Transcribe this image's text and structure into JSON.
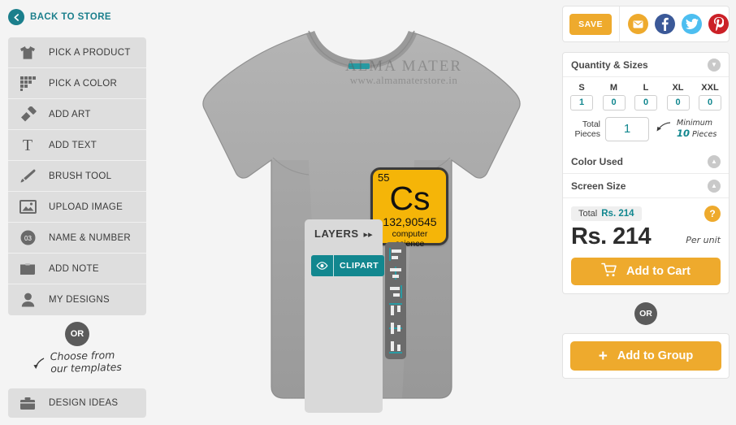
{
  "back": {
    "label": "BACK TO STORE",
    "icon": "chevron-left-icon",
    "color": "#1b7f8c"
  },
  "sidebar": {
    "items": [
      {
        "label": "PICK A PRODUCT",
        "icon": "tshirt-icon"
      },
      {
        "label": "PICK A COLOR",
        "icon": "color-swatch-icon"
      },
      {
        "label": "ADD ART",
        "icon": "paint-brush-wide-icon"
      },
      {
        "label": "ADD TEXT",
        "icon": "text-t-icon"
      },
      {
        "label": "BRUSH TOOL",
        "icon": "brush-icon"
      },
      {
        "label": "UPLOAD IMAGE",
        "icon": "image-icon"
      },
      {
        "label": "NAME & NUMBER",
        "icon": "number-badge-icon"
      },
      {
        "label": "ADD NOTE",
        "icon": "note-icon"
      },
      {
        "label": "MY DESIGNS",
        "icon": "user-icon"
      }
    ],
    "or_label": "OR",
    "templates_note_line1": "Choose from",
    "templates_note_line2": "our templates",
    "design_ideas": {
      "label": "DESIGN IDEAS",
      "icon": "briefcase-icon"
    }
  },
  "canvas": {
    "product": "grey-tshirt",
    "watermark_title": "ALMA MATER",
    "watermark_url": "www.almamaterstore.in",
    "shirt_color": "#a8a8a8",
    "design": {
      "type": "periodic-element-tile",
      "atomic_number": "55",
      "symbol": "Cs",
      "atomic_weight": "132,90545",
      "name": "computer science",
      "tile_color": "#f5b508",
      "border_color": "#3a3a3a"
    }
  },
  "layers": {
    "title": "LAYERS",
    "collapse_icon": "double-chevron-right-icon",
    "rows": [
      {
        "name": "CLIPART",
        "visible_icon": "eye-icon",
        "color": "#12878f"
      }
    ],
    "align_tools": [
      "align-left-icon",
      "align-center-horizontal-icon",
      "align-right-icon",
      "align-top-icon",
      "align-middle-vertical-icon",
      "align-bottom-icon"
    ]
  },
  "right": {
    "save_label": "SAVE",
    "social": [
      {
        "name": "email-icon",
        "color": "#eeaa2d"
      },
      {
        "name": "facebook-icon",
        "color": "#3b5998"
      },
      {
        "name": "twitter-icon",
        "color": "#4dbef0"
      },
      {
        "name": "pinterest-icon",
        "color": "#cb2027"
      }
    ],
    "quantity": {
      "header": "Quantity & Sizes",
      "chevron": "chevron-down-icon",
      "sizes": [
        {
          "label": "S",
          "value": "1"
        },
        {
          "label": "M",
          "value": "0"
        },
        {
          "label": "L",
          "value": "0"
        },
        {
          "label": "XL",
          "value": "0"
        },
        {
          "label": "XXL",
          "value": "0"
        }
      ],
      "total_label_line1": "Total",
      "total_label_line2": "Pieces",
      "total_value": "1",
      "arrow_icon": "arrow-left-curved-icon",
      "minimum_label": "Minimum",
      "minimum_value": "10",
      "minimum_unit": "Pieces"
    },
    "color_used": {
      "header": "Color Used",
      "chevron": "chevron-up-icon"
    },
    "screen_size": {
      "header": "Screen Size",
      "chevron": "chevron-up-icon"
    },
    "price": {
      "total_label": "Total",
      "total_value": "Rs. 214",
      "help_label": "?",
      "grand_total": "Rs. 214",
      "per_unit": "Per unit",
      "add_to_cart": "Add to Cart",
      "cart_icon": "shopping-cart-icon",
      "accent": "#eeaa2d",
      "teal": "#12878f"
    },
    "or_label": "OR",
    "group": {
      "add_to_group": "Add to Group",
      "plus": "+"
    }
  }
}
